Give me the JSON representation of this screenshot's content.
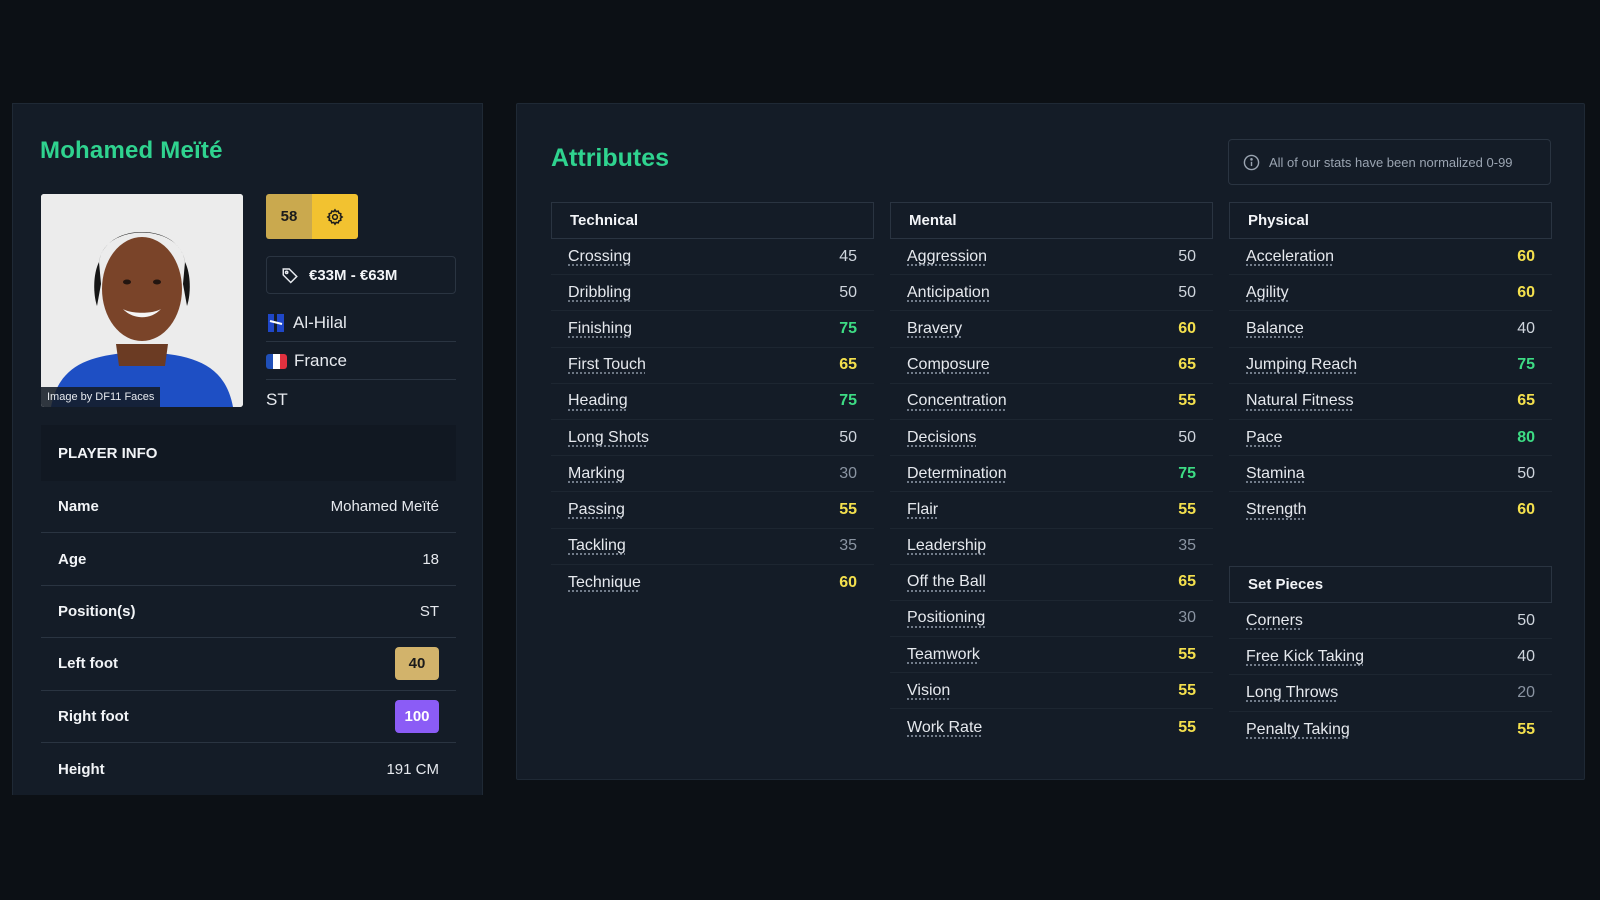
{
  "player": {
    "name": "Mohamed Meïté",
    "photo_credit": "Image by DF11 Faces",
    "rating": "58",
    "value_range": "€33M - €63M",
    "club": "Al-Hilal",
    "nation": "France",
    "position": "ST"
  },
  "player_info": {
    "header": "PLAYER INFO",
    "rows": [
      {
        "label": "Name",
        "value": "Mohamed Meïté"
      },
      {
        "label": "Age",
        "value": "18"
      },
      {
        "label": "Position(s)",
        "value": "ST"
      },
      {
        "label": "Left foot",
        "value": "40"
      },
      {
        "label": "Right foot",
        "value": "100"
      },
      {
        "label": "Height",
        "value": "191 CM"
      }
    ]
  },
  "attributes": {
    "title": "Attributes",
    "note": "All of our stats have been normalized 0-99",
    "technical": {
      "header": "Technical",
      "items": [
        {
          "name": "Crossing",
          "value": "45",
          "tier": "normal"
        },
        {
          "name": "Dribbling",
          "value": "50",
          "tier": "normal"
        },
        {
          "name": "Finishing",
          "value": "75",
          "tier": "green"
        },
        {
          "name": "First Touch",
          "value": "65",
          "tier": "yellow"
        },
        {
          "name": "Heading",
          "value": "75",
          "tier": "green"
        },
        {
          "name": "Long Shots",
          "value": "50",
          "tier": "normal"
        },
        {
          "name": "Marking",
          "value": "30",
          "tier": "low"
        },
        {
          "name": "Passing",
          "value": "55",
          "tier": "yellow"
        },
        {
          "name": "Tackling",
          "value": "35",
          "tier": "low"
        },
        {
          "name": "Technique",
          "value": "60",
          "tier": "yellow"
        }
      ]
    },
    "mental": {
      "header": "Mental",
      "items": [
        {
          "name": "Aggression",
          "value": "50",
          "tier": "normal"
        },
        {
          "name": "Anticipation",
          "value": "50",
          "tier": "normal"
        },
        {
          "name": "Bravery",
          "value": "60",
          "tier": "yellow"
        },
        {
          "name": "Composure",
          "value": "65",
          "tier": "yellow"
        },
        {
          "name": "Concentration",
          "value": "55",
          "tier": "yellow"
        },
        {
          "name": "Decisions",
          "value": "50",
          "tier": "normal"
        },
        {
          "name": "Determination",
          "value": "75",
          "tier": "green"
        },
        {
          "name": "Flair",
          "value": "55",
          "tier": "yellow"
        },
        {
          "name": "Leadership",
          "value": "35",
          "tier": "low"
        },
        {
          "name": "Off the Ball",
          "value": "65",
          "tier": "yellow"
        },
        {
          "name": "Positioning",
          "value": "30",
          "tier": "low"
        },
        {
          "name": "Teamwork",
          "value": "55",
          "tier": "yellow"
        },
        {
          "name": "Vision",
          "value": "55",
          "tier": "yellow"
        },
        {
          "name": "Work Rate",
          "value": "55",
          "tier": "yellow"
        }
      ]
    },
    "physical": {
      "header": "Physical",
      "items": [
        {
          "name": "Acceleration",
          "value": "60",
          "tier": "yellow"
        },
        {
          "name": "Agility",
          "value": "60",
          "tier": "yellow"
        },
        {
          "name": "Balance",
          "value": "40",
          "tier": "normal"
        },
        {
          "name": "Jumping Reach",
          "value": "75",
          "tier": "green"
        },
        {
          "name": "Natural Fitness",
          "value": "65",
          "tier": "yellow"
        },
        {
          "name": "Pace",
          "value": "80",
          "tier": "green"
        },
        {
          "name": "Stamina",
          "value": "50",
          "tier": "normal"
        },
        {
          "name": "Strength",
          "value": "60",
          "tier": "yellow"
        }
      ]
    },
    "set_pieces": {
      "header": "Set Pieces",
      "items": [
        {
          "name": "Corners",
          "value": "50",
          "tier": "normal"
        },
        {
          "name": "Free Kick Taking",
          "value": "40",
          "tier": "normal"
        },
        {
          "name": "Long Throws",
          "value": "20",
          "tier": "low"
        },
        {
          "name": "Penalty Taking",
          "value": "55",
          "tier": "yellow"
        }
      ]
    }
  },
  "icons": {
    "rating": "gear-icon",
    "value": "price-tag-icon",
    "club": "al-hilal-crest-icon",
    "nation": "france-flag-icon",
    "note": "info-icon"
  },
  "colors": {
    "accent": "#2fd38f",
    "rating_bg": "#caa94e",
    "rating_icon_bg": "#f2c230",
    "value_green": "#3ddc84",
    "value_yellow": "#f4e04d",
    "foot_left_badge": "#d2b36b",
    "foot_right_badge": "#8b5cf6",
    "france_flag": [
      "#1f4fb8",
      "#ffffff",
      "#e0313f"
    ]
  }
}
